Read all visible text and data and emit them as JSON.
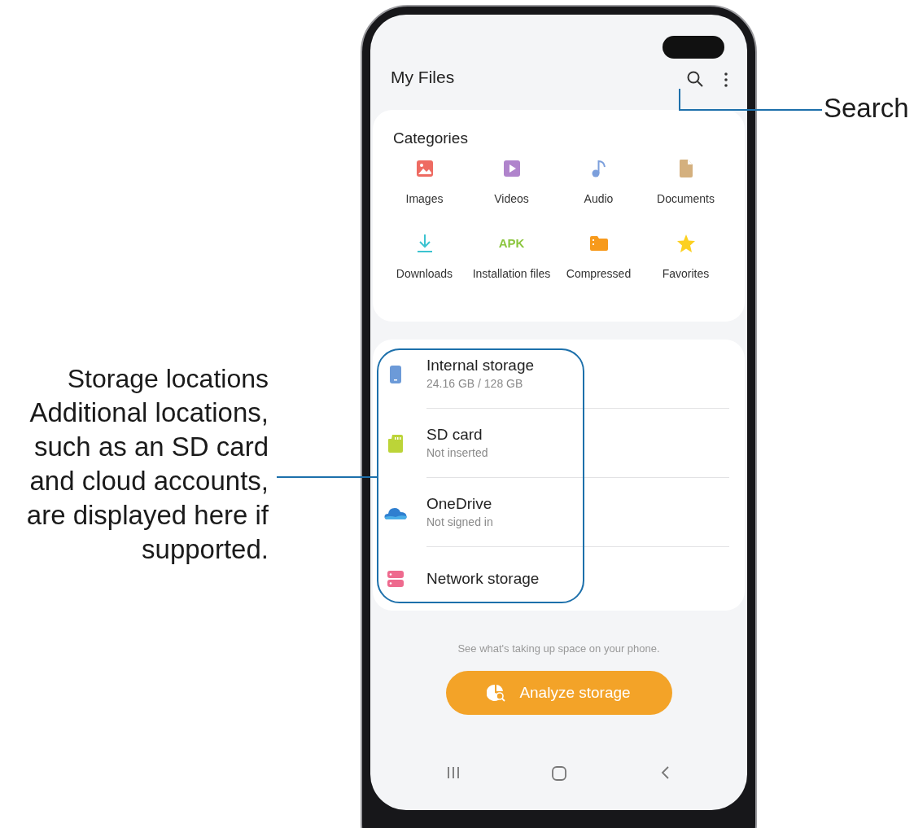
{
  "app": {
    "title": "My Files"
  },
  "categories": {
    "title": "Categories",
    "items": [
      {
        "label": "Images",
        "kind": "images"
      },
      {
        "label": "Videos",
        "kind": "videos"
      },
      {
        "label": "Audio",
        "kind": "audio"
      },
      {
        "label": "Documents",
        "kind": "documents"
      },
      {
        "label": "Downloads",
        "kind": "downloads"
      },
      {
        "label": "Installation files",
        "kind": "apk",
        "icon_text": "APK"
      },
      {
        "label": "Compressed",
        "kind": "compressed"
      },
      {
        "label": "Favorites",
        "kind": "favorites"
      }
    ]
  },
  "storage": [
    {
      "name": "Internal storage",
      "detail": "24.16 GB / 128 GB",
      "kind": "phone"
    },
    {
      "name": "SD card",
      "detail": "Not inserted",
      "kind": "sdcard"
    },
    {
      "name": "OneDrive",
      "detail": "Not signed in",
      "kind": "cloud"
    },
    {
      "name": "Network storage",
      "kind": "network"
    }
  ],
  "hint": "See what's taking up space on your phone.",
  "analyze_button": {
    "label": "Analyze storage"
  },
  "callouts": {
    "search": "Search",
    "storage_title": "Storage locations",
    "storage_text": "Additional locations, such as an SD card and cloud accounts, are displayed here if supported."
  }
}
